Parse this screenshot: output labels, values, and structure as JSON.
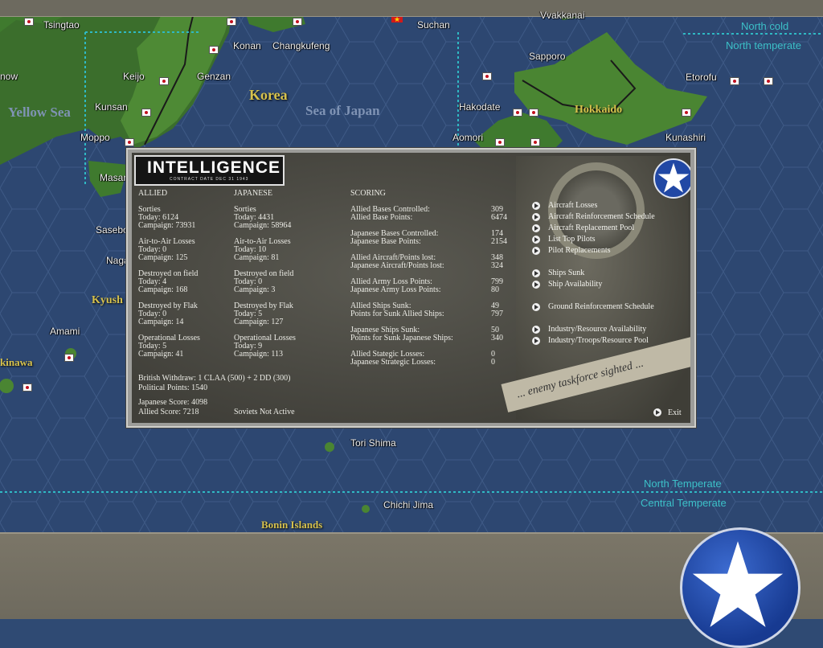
{
  "map": {
    "places": [
      "Tsingtao",
      "Konan",
      "Changkufeng",
      "Suchan",
      "Vvakkanai",
      "Keijo",
      "Genzan",
      "Sapporo",
      "Etorofu",
      "now",
      "Kunsan",
      "Hakodate",
      "Moppo",
      "Aomori",
      "Kunashiri",
      "Masan",
      "Sasebo",
      "Naga",
      "Amami",
      "Tori Shima",
      "Chichi Jima",
      "Kyush",
      "kinawa"
    ],
    "regions": [
      "Korea",
      "Hokkaido",
      "Bonin Islands"
    ],
    "seas": [
      "Yellow Sea",
      "Sea of Japan"
    ],
    "climate": [
      "North cold",
      "North temperate",
      "North Temperate",
      "Central Temperate"
    ]
  },
  "dialog": {
    "title": "INTELLIGENCE",
    "subtitle": "CONTRACT DATE DEC 31 1943",
    "allied": {
      "header": "ALLIED",
      "sorties_label": "Sorties",
      "sorties_today": "Today:     6124",
      "sorties_campaign": "Campaign: 73931",
      "ata_label": "Air-to-Air Losses",
      "ata_today": "Today:     0",
      "ata_campaign": "Campaign: 125",
      "dof_label": "Destroyed on field",
      "dof_today": "Today:     4",
      "dof_campaign": "Campaign: 168",
      "dbf_label": "Destroyed by Flak",
      "dbf_today": "Today:     0",
      "dbf_campaign": "Campaign: 14",
      "ol_label": "Operational Losses",
      "ol_today": "Today:     5",
      "ol_campaign": "Campaign: 41"
    },
    "japanese": {
      "header": "JAPANESE",
      "sorties_label": "Sorties",
      "sorties_today": "Today:     4431",
      "sorties_campaign": "Campaign: 58964",
      "ata_label": "Air-to-Air Losses",
      "ata_today": "Today:     10",
      "ata_campaign": "Campaign: 81",
      "dof_label": "Destroyed on field",
      "dof_today": "Today:     0",
      "dof_campaign": "Campaign: 3",
      "dbf_label": "Destroyed by Flak",
      "dbf_today": "Today:     5",
      "dbf_campaign": "Campaign: 127",
      "ol_label": "Operational Losses",
      "ol_today": "Today:     9",
      "ol_campaign": "Campaign: 113"
    },
    "british_withdraw": "British Withdraw: 1 CLAA (500) + 2 DD (300)",
    "political_points": "Political Points: 1540",
    "japanese_score": "Japanese Score: 4098",
    "allied_score": "Allied Score: 7218",
    "soviets": "Soviets Not Active",
    "scoring": {
      "header": "SCORING",
      "rows": [
        [
          "Allied Bases Controlled:",
          "309"
        ],
        [
          "Allied Base Points:",
          "6474"
        ],
        [
          "Japanese Bases Controlled:",
          "174"
        ],
        [
          "Japanese Base Points:",
          "2154"
        ],
        [
          "Allied Aircraft/Points lost:",
          "348"
        ],
        [
          "Japanese Aircraft/Points lost:",
          "324"
        ],
        [
          "Allied Army Loss Points:",
          "799"
        ],
        [
          "Japanese Army Loss Points:",
          "80"
        ],
        [
          "Allied Ships Sunk:",
          "49"
        ],
        [
          "Points for Sunk Allied Ships:",
          "797"
        ],
        [
          "Japanese Ships Sunk:",
          "50"
        ],
        [
          "Points for Sunk Japanese Ships:",
          "340"
        ],
        [
          "Allied Stategic Losses:",
          "0"
        ],
        [
          "Japanese Strategic Losses:",
          "0"
        ]
      ]
    },
    "menu": [
      "Aircraft Losses",
      "Aircraft Reinforcement Schedule",
      "Aircraft Replacement Pool",
      "List Top Pilots",
      "Pilot Replacements",
      "Ships Sunk",
      "Ship Availability",
      "Ground Reinforcement Schedule",
      "Industry/Resource Availability",
      "Industry/Troops/Resource Pool"
    ],
    "exit": "Exit",
    "strip_text": "... enemy taskforce sighted ..."
  },
  "colors": {
    "ocean": "#2f4a73",
    "land": "#3f7a2e",
    "climate_line": "#2fb9c4",
    "region_text": "#d7c24d"
  }
}
